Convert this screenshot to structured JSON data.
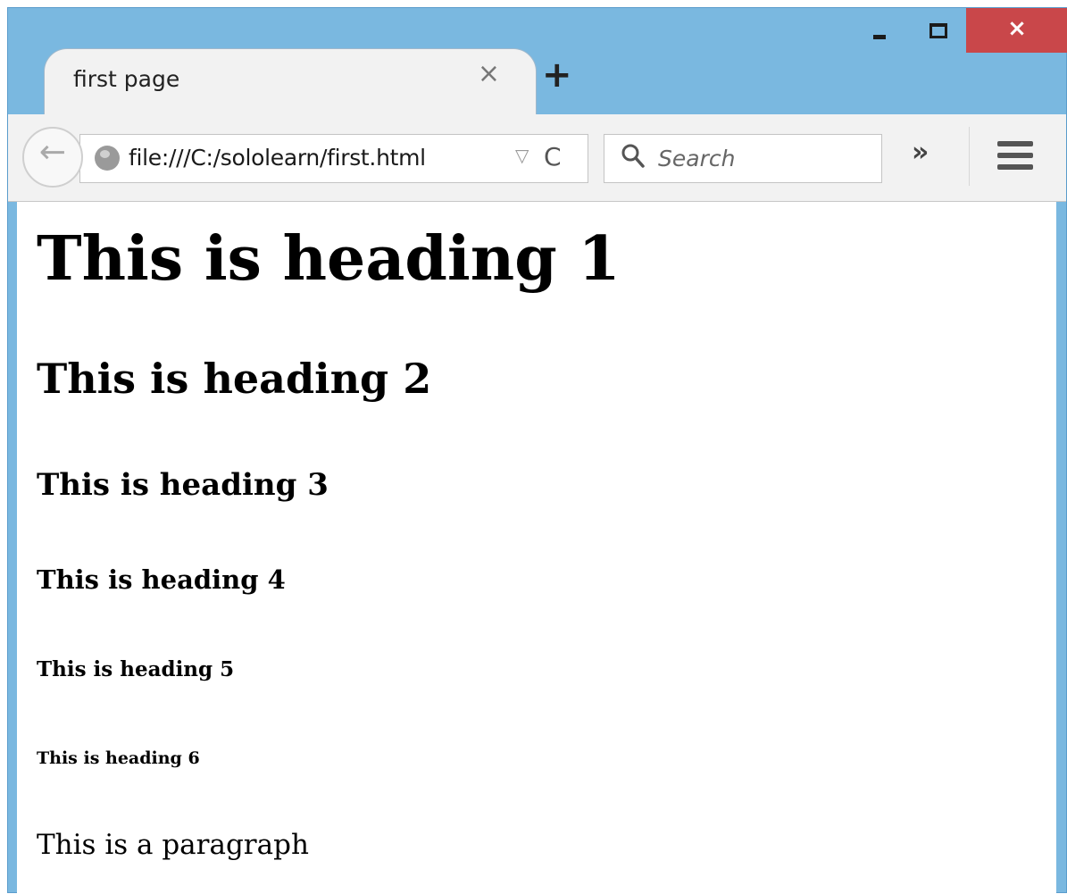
{
  "window": {
    "title_bar_color": "#7ab8e0",
    "close_color": "#c9474a",
    "close_glyph": "×"
  },
  "tab": {
    "title": "first page",
    "close_glyph": "×",
    "new_tab_glyph": "+"
  },
  "toolbar": {
    "back_glyph": "←",
    "url": "file:///C:/sololearn/first.html",
    "dropdown_glyph": "▽",
    "reload_glyph": "C",
    "search_placeholder": "Search",
    "overflow_glyph": "»",
    "icons": [
      "back-icon",
      "globe-icon",
      "dropdown-icon",
      "reload-icon",
      "search-icon",
      "overflow-icon",
      "hamburger-menu-icon"
    ]
  },
  "page": {
    "h1": "This is heading 1",
    "h2": "This is heading 2",
    "h3": "This is heading 3",
    "h4": "This is heading 4",
    "h5": "This is heading 5",
    "h6": "This is heading 6",
    "paragraph": "This is a paragraph"
  }
}
